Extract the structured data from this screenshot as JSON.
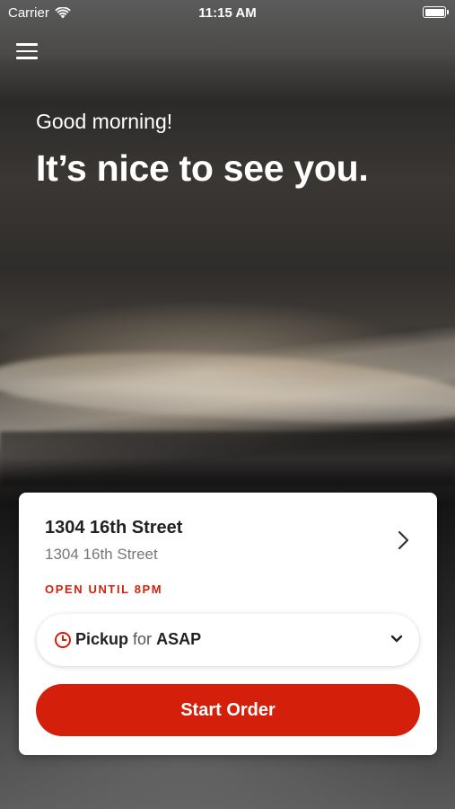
{
  "status_bar": {
    "carrier": "Carrier",
    "time": "11:15 AM",
    "wifi_icon": "wifi-icon",
    "battery_icon": "battery-icon"
  },
  "header": {
    "menu_icon": "hamburger-menu-icon",
    "greeting": "Good morning!",
    "headline": "It’s nice to see you."
  },
  "location": {
    "name": "1304 16th Street",
    "address": "1304 16th Street",
    "hours": "OPEN UNTIL 8PM",
    "chevron_icon": "chevron-right-icon"
  },
  "pickup": {
    "clock_icon": "clock-icon",
    "mode": "Pickup",
    "for_word": "for",
    "time": "ASAP",
    "dropdown_icon": "chevron-down-icon"
  },
  "actions": {
    "start_order": "Start Order"
  },
  "colors": {
    "accent": "#d4200a",
    "hours_text": "#d2220c",
    "card_bg": "#ffffff"
  }
}
